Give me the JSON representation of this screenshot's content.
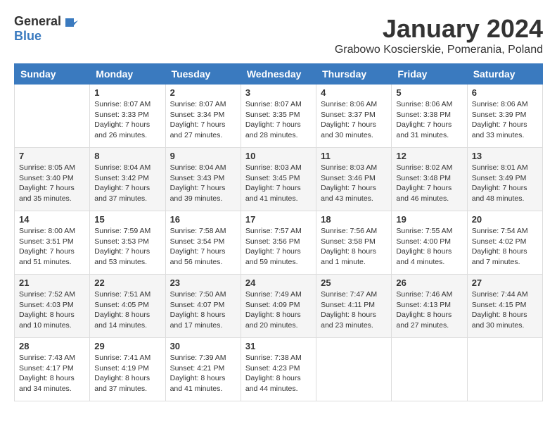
{
  "logo": {
    "general": "General",
    "blue": "Blue"
  },
  "header": {
    "month": "January 2024",
    "location": "Grabowo Koscierskie, Pomerania, Poland"
  },
  "weekdays": [
    "Sunday",
    "Monday",
    "Tuesday",
    "Wednesday",
    "Thursday",
    "Friday",
    "Saturday"
  ],
  "weeks": [
    [
      {
        "day": "",
        "sunrise": "",
        "sunset": "",
        "daylight": ""
      },
      {
        "day": "1",
        "sunrise": "Sunrise: 8:07 AM",
        "sunset": "Sunset: 3:33 PM",
        "daylight": "Daylight: 7 hours and 26 minutes."
      },
      {
        "day": "2",
        "sunrise": "Sunrise: 8:07 AM",
        "sunset": "Sunset: 3:34 PM",
        "daylight": "Daylight: 7 hours and 27 minutes."
      },
      {
        "day": "3",
        "sunrise": "Sunrise: 8:07 AM",
        "sunset": "Sunset: 3:35 PM",
        "daylight": "Daylight: 7 hours and 28 minutes."
      },
      {
        "day": "4",
        "sunrise": "Sunrise: 8:06 AM",
        "sunset": "Sunset: 3:37 PM",
        "daylight": "Daylight: 7 hours and 30 minutes."
      },
      {
        "day": "5",
        "sunrise": "Sunrise: 8:06 AM",
        "sunset": "Sunset: 3:38 PM",
        "daylight": "Daylight: 7 hours and 31 minutes."
      },
      {
        "day": "6",
        "sunrise": "Sunrise: 8:06 AM",
        "sunset": "Sunset: 3:39 PM",
        "daylight": "Daylight: 7 hours and 33 minutes."
      }
    ],
    [
      {
        "day": "7",
        "sunrise": "Sunrise: 8:05 AM",
        "sunset": "Sunset: 3:40 PM",
        "daylight": "Daylight: 7 hours and 35 minutes."
      },
      {
        "day": "8",
        "sunrise": "Sunrise: 8:04 AM",
        "sunset": "Sunset: 3:42 PM",
        "daylight": "Daylight: 7 hours and 37 minutes."
      },
      {
        "day": "9",
        "sunrise": "Sunrise: 8:04 AM",
        "sunset": "Sunset: 3:43 PM",
        "daylight": "Daylight: 7 hours and 39 minutes."
      },
      {
        "day": "10",
        "sunrise": "Sunrise: 8:03 AM",
        "sunset": "Sunset: 3:45 PM",
        "daylight": "Daylight: 7 hours and 41 minutes."
      },
      {
        "day": "11",
        "sunrise": "Sunrise: 8:03 AM",
        "sunset": "Sunset: 3:46 PM",
        "daylight": "Daylight: 7 hours and 43 minutes."
      },
      {
        "day": "12",
        "sunrise": "Sunrise: 8:02 AM",
        "sunset": "Sunset: 3:48 PM",
        "daylight": "Daylight: 7 hours and 46 minutes."
      },
      {
        "day": "13",
        "sunrise": "Sunrise: 8:01 AM",
        "sunset": "Sunset: 3:49 PM",
        "daylight": "Daylight: 7 hours and 48 minutes."
      }
    ],
    [
      {
        "day": "14",
        "sunrise": "Sunrise: 8:00 AM",
        "sunset": "Sunset: 3:51 PM",
        "daylight": "Daylight: 7 hours and 51 minutes."
      },
      {
        "day": "15",
        "sunrise": "Sunrise: 7:59 AM",
        "sunset": "Sunset: 3:53 PM",
        "daylight": "Daylight: 7 hours and 53 minutes."
      },
      {
        "day": "16",
        "sunrise": "Sunrise: 7:58 AM",
        "sunset": "Sunset: 3:54 PM",
        "daylight": "Daylight: 7 hours and 56 minutes."
      },
      {
        "day": "17",
        "sunrise": "Sunrise: 7:57 AM",
        "sunset": "Sunset: 3:56 PM",
        "daylight": "Daylight: 7 hours and 59 minutes."
      },
      {
        "day": "18",
        "sunrise": "Sunrise: 7:56 AM",
        "sunset": "Sunset: 3:58 PM",
        "daylight": "Daylight: 8 hours and 1 minute."
      },
      {
        "day": "19",
        "sunrise": "Sunrise: 7:55 AM",
        "sunset": "Sunset: 4:00 PM",
        "daylight": "Daylight: 8 hours and 4 minutes."
      },
      {
        "day": "20",
        "sunrise": "Sunrise: 7:54 AM",
        "sunset": "Sunset: 4:02 PM",
        "daylight": "Daylight: 8 hours and 7 minutes."
      }
    ],
    [
      {
        "day": "21",
        "sunrise": "Sunrise: 7:52 AM",
        "sunset": "Sunset: 4:03 PM",
        "daylight": "Daylight: 8 hours and 10 minutes."
      },
      {
        "day": "22",
        "sunrise": "Sunrise: 7:51 AM",
        "sunset": "Sunset: 4:05 PM",
        "daylight": "Daylight: 8 hours and 14 minutes."
      },
      {
        "day": "23",
        "sunrise": "Sunrise: 7:50 AM",
        "sunset": "Sunset: 4:07 PM",
        "daylight": "Daylight: 8 hours and 17 minutes."
      },
      {
        "day": "24",
        "sunrise": "Sunrise: 7:49 AM",
        "sunset": "Sunset: 4:09 PM",
        "daylight": "Daylight: 8 hours and 20 minutes."
      },
      {
        "day": "25",
        "sunrise": "Sunrise: 7:47 AM",
        "sunset": "Sunset: 4:11 PM",
        "daylight": "Daylight: 8 hours and 23 minutes."
      },
      {
        "day": "26",
        "sunrise": "Sunrise: 7:46 AM",
        "sunset": "Sunset: 4:13 PM",
        "daylight": "Daylight: 8 hours and 27 minutes."
      },
      {
        "day": "27",
        "sunrise": "Sunrise: 7:44 AM",
        "sunset": "Sunset: 4:15 PM",
        "daylight": "Daylight: 8 hours and 30 minutes."
      }
    ],
    [
      {
        "day": "28",
        "sunrise": "Sunrise: 7:43 AM",
        "sunset": "Sunset: 4:17 PM",
        "daylight": "Daylight: 8 hours and 34 minutes."
      },
      {
        "day": "29",
        "sunrise": "Sunrise: 7:41 AM",
        "sunset": "Sunset: 4:19 PM",
        "daylight": "Daylight: 8 hours and 37 minutes."
      },
      {
        "day": "30",
        "sunrise": "Sunrise: 7:39 AM",
        "sunset": "Sunset: 4:21 PM",
        "daylight": "Daylight: 8 hours and 41 minutes."
      },
      {
        "day": "31",
        "sunrise": "Sunrise: 7:38 AM",
        "sunset": "Sunset: 4:23 PM",
        "daylight": "Daylight: 8 hours and 44 minutes."
      },
      {
        "day": "",
        "sunrise": "",
        "sunset": "",
        "daylight": ""
      },
      {
        "day": "",
        "sunrise": "",
        "sunset": "",
        "daylight": ""
      },
      {
        "day": "",
        "sunrise": "",
        "sunset": "",
        "daylight": ""
      }
    ]
  ]
}
